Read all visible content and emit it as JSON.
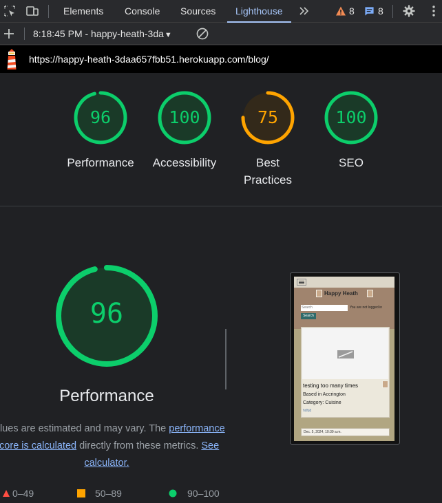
{
  "tabs": {
    "items": [
      {
        "label": "Elements"
      },
      {
        "label": "Console"
      },
      {
        "label": "Sources"
      },
      {
        "label": "Lighthouse"
      }
    ],
    "warnings_count": "8",
    "messages_count": "8"
  },
  "toolbar": {
    "report_label": "8:18:45 PM - happy-heath-3da"
  },
  "url": "https://happy-heath-3daa657fbb51.herokuapp.com/blog/",
  "scores": [
    {
      "value": "96",
      "label": "Performance",
      "level": 0.96,
      "color": "#0cce6b"
    },
    {
      "value": "100",
      "label": "Accessibility",
      "level": 1.0,
      "color": "#0cce6b"
    },
    {
      "value": "75",
      "label": "Best Practices",
      "level": 0.75,
      "color": "#ffa400"
    },
    {
      "value": "100",
      "label": "SEO",
      "level": 1.0,
      "color": "#0cce6b"
    }
  ],
  "performance": {
    "score": "96",
    "level": 0.96,
    "title": "Performance",
    "desc_part1": "Values are estimated and may vary. The ",
    "desc_link1": "performance score is calculated",
    "desc_part2": " directly from these metrics. ",
    "desc_link2": "See calculator."
  },
  "legend": [
    {
      "range": "0–49",
      "color": "#ff4e42"
    },
    {
      "range": "50–89",
      "color": "#ffa400"
    },
    {
      "range": "90–100",
      "color": "#0cce6b"
    }
  ],
  "preview": {
    "site_title": "Happy Heath",
    "search_placeholder": "Search",
    "login_status": "You are not logged in",
    "search_button": "Search",
    "post_title": "testing too many times",
    "post_location": "Based in Accrington",
    "post_category": "Category: Cuisine",
    "post_author": "hdhjd",
    "post_date": "Dec. 5, 2024, 10:39 a.m."
  },
  "colors": {
    "good": "#0cce6b",
    "average": "#ffa400",
    "accent": "#a8c7fa"
  }
}
